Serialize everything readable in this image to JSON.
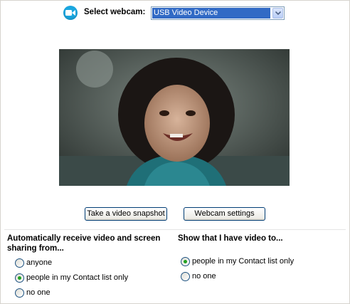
{
  "header": {
    "select_label": "Select webcam:",
    "selected_device": "USB Video Device",
    "icon": "webcam-icon"
  },
  "buttons": {
    "snapshot": "Take a video snapshot",
    "settings": "Webcam settings"
  },
  "receive": {
    "title": "Automatically receive video and screen sharing from...",
    "options": [
      {
        "label": "anyone",
        "checked": false
      },
      {
        "label": "people in my Contact list only",
        "checked": true
      },
      {
        "label": "no one",
        "checked": false
      }
    ]
  },
  "show": {
    "title": "Show that I have video to...",
    "options": [
      {
        "label": "people in my Contact list only",
        "checked": true
      },
      {
        "label": "no one",
        "checked": false
      }
    ]
  },
  "colors": {
    "accent": "#1aa7e0",
    "selection": "#316ac5",
    "radio_dot": "#21a121"
  }
}
